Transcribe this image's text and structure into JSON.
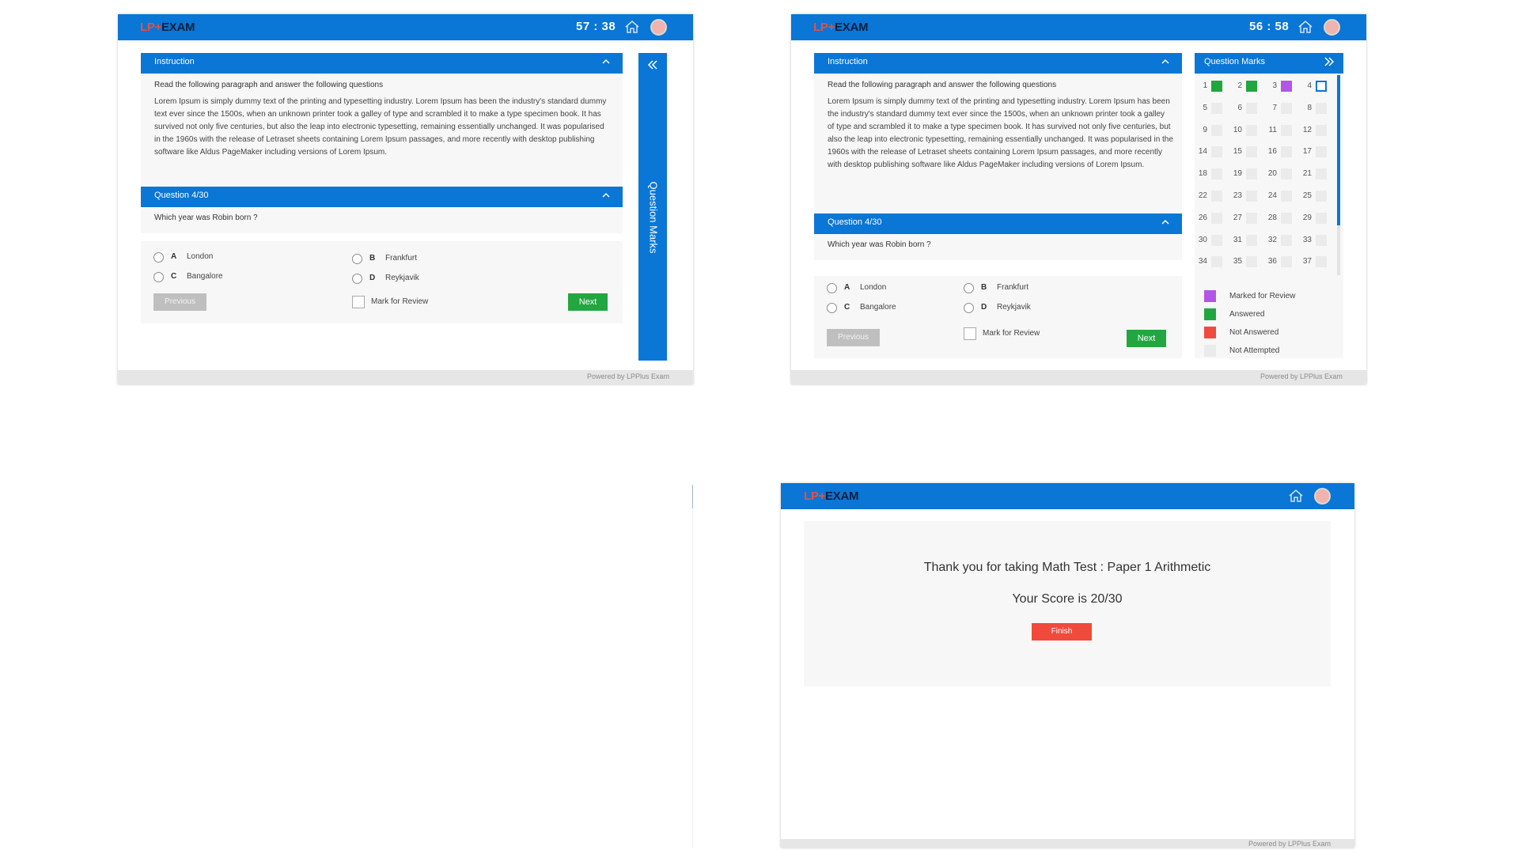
{
  "colors": {
    "primary_blue": "#0a76d6",
    "next_green": "#22a640",
    "finish_red": "#ef4a3c",
    "marked_purple": "#b455e8",
    "not_answered_red": "#ef4a3c",
    "not_attempted_gray": "#ebebeb",
    "logo_accent": "#e8503a"
  },
  "brand": {
    "prefix": "LP+",
    "name": "EXAM"
  },
  "icons": {
    "home": "home-icon",
    "collapse": "chevron-up-icon",
    "expand_rail": "double-chevron-left-icon",
    "collapse_rail": "double-chevron-right-icon"
  },
  "screen_a": {
    "timer": "57 : 38",
    "instruction": {
      "title": "Instruction",
      "lead": "Read the following paragraph and answer the following questions",
      "paragraph": "Lorem Ipsum is simply dummy text of the printing and typesetting industry. Lorem Ipsum has been the industry's standard dummy text ever since the 1500s, when an unknown printer took a galley of type and scrambled it to make a type specimen book. It has survived not only five centuries, but also the leap into electronic typesetting, remaining essentially unchanged. It was popularised in the 1960s with the release of Letraset sheets containing Lorem Ipsum passages, and more recently with desktop publishing software like Aldus PageMaker including versions of Lorem Ipsum."
    },
    "question": {
      "title": "Question   4/30",
      "text": "Which year was Robin born ?",
      "options": [
        {
          "letter": "A",
          "label": "London"
        },
        {
          "letter": "B",
          "label": "Frankfurt"
        },
        {
          "letter": "C",
          "label": "Bangalore"
        },
        {
          "letter": "D",
          "label": "Reykjavik"
        }
      ]
    },
    "previous_label": "Previous",
    "review_label": "Mark for Review",
    "next_label": "Next",
    "rail_label": "Question Marks",
    "footer": "Powered by LPPlus Exam"
  },
  "screen_b": {
    "timer": "56 : 58",
    "instruction": {
      "title": "Instruction",
      "lead": "Read the following paragraph and answer the following questions",
      "paragraph": "Lorem Ipsum is simply dummy text of the printing and typesetting industry. Lorem Ipsum has been the industry's standard dummy text ever since the 1500s, when an unknown printer took a galley of type and scrambled it to make a type specimen book. It has survived not only five centuries, but also the leap into electronic typesetting, remaining essentially unchanged. It was popularised in the 1960s with the release of Letraset sheets containing Lorem Ipsum passages, and more recently with desktop publishing software like Aldus PageMaker including versions of Lorem Ipsum."
    },
    "question": {
      "title": "Question   4/30",
      "text": "Which year was Robin born ?",
      "options": [
        {
          "letter": "A",
          "label": "London"
        },
        {
          "letter": "B",
          "label": "Frankfurt"
        },
        {
          "letter": "C",
          "label": "Bangalore"
        },
        {
          "letter": "D",
          "label": "Reykjavik"
        }
      ]
    },
    "previous_label": "Previous",
    "review_label": "Mark for Review",
    "next_label": "Next",
    "marks_panel": {
      "title": "Question Marks",
      "questions": [
        {
          "n": "1",
          "status": "answered"
        },
        {
          "n": "2",
          "status": "answered"
        },
        {
          "n": "3",
          "status": "marked"
        },
        {
          "n": "4",
          "status": "current"
        },
        {
          "n": "5",
          "status": "not-attempted"
        },
        {
          "n": "6",
          "status": "not-attempted"
        },
        {
          "n": "7",
          "status": "not-attempted"
        },
        {
          "n": "8",
          "status": "not-attempted"
        },
        {
          "n": "9",
          "status": "not-attempted"
        },
        {
          "n": "10",
          "status": "not-attempted"
        },
        {
          "n": "11",
          "status": "not-attempted"
        },
        {
          "n": "12",
          "status": "not-attempted"
        },
        {
          "n": "14",
          "status": "not-attempted"
        },
        {
          "n": "15",
          "status": "not-attempted"
        },
        {
          "n": "16",
          "status": "not-attempted"
        },
        {
          "n": "17",
          "status": "not-attempted"
        },
        {
          "n": "18",
          "status": "not-attempted"
        },
        {
          "n": "19",
          "status": "not-attempted"
        },
        {
          "n": "20",
          "status": "not-attempted"
        },
        {
          "n": "21",
          "status": "not-attempted"
        },
        {
          "n": "22",
          "status": "not-attempted"
        },
        {
          "n": "23",
          "status": "not-attempted"
        },
        {
          "n": "24",
          "status": "not-attempted"
        },
        {
          "n": "25",
          "status": "not-attempted"
        },
        {
          "n": "26",
          "status": "not-attempted"
        },
        {
          "n": "27",
          "status": "not-attempted"
        },
        {
          "n": "28",
          "status": "not-attempted"
        },
        {
          "n": "29",
          "status": "not-attempted"
        },
        {
          "n": "30",
          "status": "not-attempted"
        },
        {
          "n": "31",
          "status": "not-attempted"
        },
        {
          "n": "32",
          "status": "not-attempted"
        },
        {
          "n": "33",
          "status": "not-attempted"
        },
        {
          "n": "34",
          "status": "not-attempted"
        },
        {
          "n": "35",
          "status": "not-attempted"
        },
        {
          "n": "36",
          "status": "not-attempted"
        },
        {
          "n": "37",
          "status": "not-attempted"
        }
      ],
      "legend": [
        {
          "label": "Marked for Review",
          "color": "#b455e8"
        },
        {
          "label": "Answered",
          "color": "#22a640"
        },
        {
          "label": "Not Answered",
          "color": "#ef4a3c"
        },
        {
          "label": "Not Attempted",
          "color": "#ebebeb"
        }
      ]
    },
    "footer": "Powered by LPPlus Exam"
  },
  "screen_c": {
    "thanks": "Thank you for taking Math Test : Paper 1 Arithmetic",
    "score": "Your Score is 20/30",
    "finish_label": "Finish",
    "footer": "Powered by LPPlus Exam"
  }
}
